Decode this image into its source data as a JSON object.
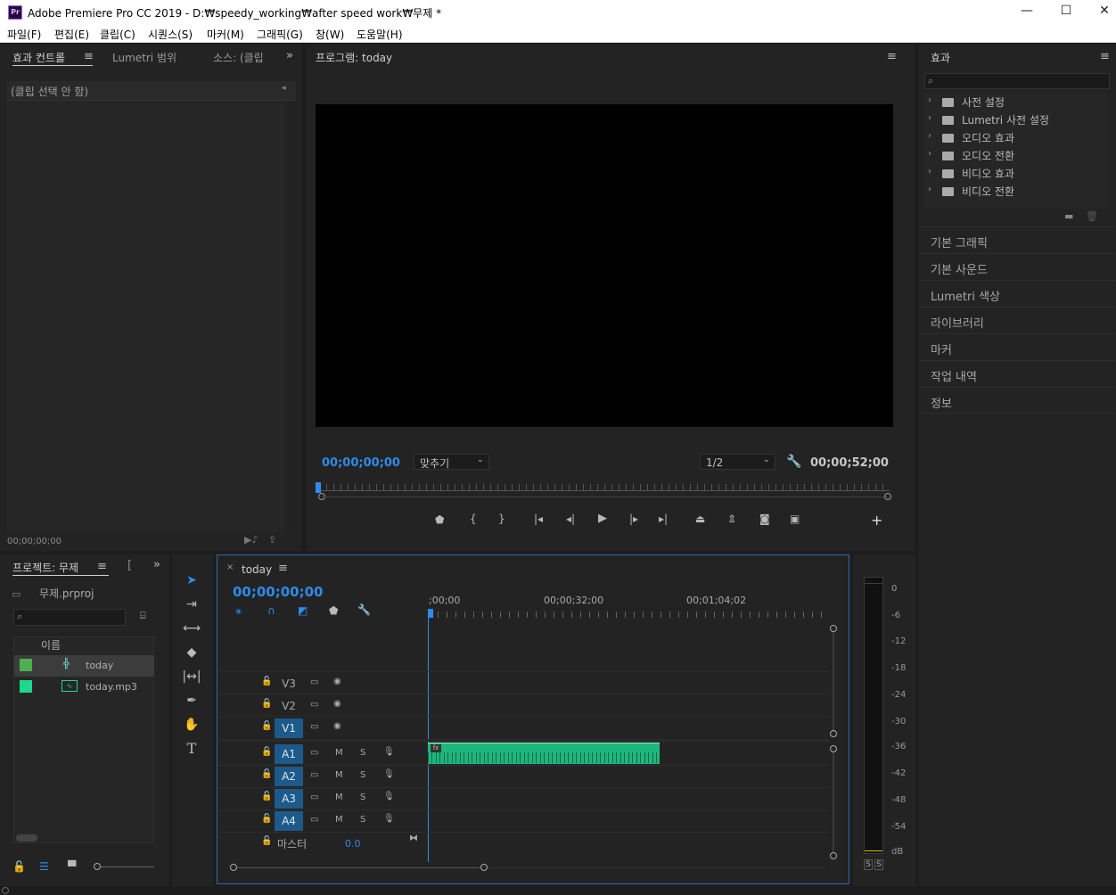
{
  "window": {
    "logo_text": "Pr",
    "title": "Adobe Premiere Pro CC 2019 - D:₩speedy_working₩after speed work₩무제 *",
    "min_glyph": "—",
    "max_glyph": "☐",
    "close_glyph": "✕"
  },
  "menu": [
    "파일(F)",
    "편집(E)",
    "클립(C)",
    "시퀀스(S)",
    "마커(M)",
    "그래픽(G)",
    "창(W)",
    "도움말(H)"
  ],
  "effect_controls": {
    "tabs": [
      "효과 컨트롤",
      "Lumetri 범위",
      "소스: (클립"
    ],
    "placeholder": "(클립 선택 안 함)",
    "timecode": "00;00;00;00"
  },
  "program_monitor": {
    "title": "프로그램: today",
    "timecode_current": "00;00;00;00",
    "fit_label": "맞추기",
    "resolution": "1/2",
    "timecode_duration": "00;00;52;00"
  },
  "effects_panel": {
    "title": "효과",
    "search_placeholder": "",
    "folders": [
      "사전 설정",
      "Lumetri 사전 설정",
      "오디오 효과",
      "오디오 전환",
      "비디오 효과",
      "비디오 전환"
    ],
    "sections": [
      "기본 그래픽",
      "기본 사운드",
      "Lumetri 색상",
      "라이브러리",
      "마커",
      "작업 내역",
      "정보"
    ]
  },
  "project_panel": {
    "title": "프로젝트: 무제",
    "file": "무제.prproj",
    "column_name": "이름",
    "items": [
      {
        "name": "today",
        "color": "#4caf50"
      },
      {
        "name": "today.mp3",
        "color": "#1ed98c"
      }
    ]
  },
  "timeline": {
    "tab": "today",
    "timecode": "00;00;00;00",
    "ruler": [
      ";00;00",
      "00;00;32;00",
      "00;01;04;02"
    ],
    "video_tracks": [
      "V3",
      "V2",
      "V1"
    ],
    "audio_tracks": [
      "A1",
      "A2",
      "A3",
      "A4"
    ],
    "mute_label": "M",
    "solo_label": "S",
    "master_label": "마스터",
    "master_value": "0.0",
    "clip_color": "#1fb67e"
  },
  "audio_meter": {
    "scale": [
      "0",
      "-6",
      "-12",
      "-18",
      "-24",
      "-30",
      "-36",
      "-42",
      "-48",
      "-54",
      "dB"
    ],
    "solo_buttons": [
      "S",
      "S"
    ]
  }
}
